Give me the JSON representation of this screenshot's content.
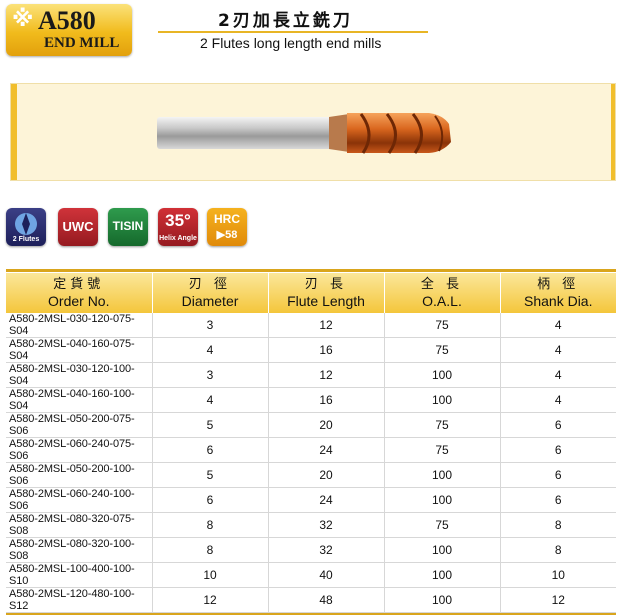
{
  "header": {
    "mark": "※",
    "model": "A580",
    "product_name": "END MILL",
    "title_zh": "2刃加長立銑刀",
    "title_en": "2 Flutes long length end mills"
  },
  "colors": {
    "accent_gold": "#f1be2c",
    "panel_bg": "#fdf4d8",
    "coating_orange": "#d9661e"
  },
  "features": [
    {
      "id": "flutes",
      "icon": "two-flute-icon",
      "label": "2 Flutes",
      "color": "#2a2d6e"
    },
    {
      "id": "material",
      "icon": "uwc-icon",
      "label": "UWC",
      "color": "#c0282f"
    },
    {
      "id": "coating",
      "icon": "tisin-icon",
      "label": "TISIN",
      "color": "#1f7f3a"
    },
    {
      "id": "helix",
      "icon": "helix-icon",
      "value": "35°",
      "label": "Helix Angle",
      "color": "#c0282f"
    },
    {
      "id": "hrc",
      "icon": "hrc-icon",
      "label": "HRC",
      "value": "▶58",
      "color": "#f0a81a"
    }
  ],
  "table": {
    "columns": [
      {
        "zh": "定貨號",
        "en": "Order No."
      },
      {
        "zh": "刃 徑",
        "en": "Diameter"
      },
      {
        "zh": "刃 長",
        "en": "Flute Length"
      },
      {
        "zh": "全 長",
        "en": "O.A.L."
      },
      {
        "zh": "柄 徑",
        "en": "Shank Dia."
      }
    ],
    "rows": [
      [
        "A580-2MSL-030-120-075-S04",
        "3",
        "12",
        "75",
        "4"
      ],
      [
        "A580-2MSL-040-160-075-S04",
        "4",
        "16",
        "75",
        "4"
      ],
      [
        "A580-2MSL-030-120-100-S04",
        "3",
        "12",
        "100",
        "4"
      ],
      [
        "A580-2MSL-040-160-100-S04",
        "4",
        "16",
        "100",
        "4"
      ],
      [
        "A580-2MSL-050-200-075-S06",
        "5",
        "20",
        "75",
        "6"
      ],
      [
        "A580-2MSL-060-240-075-S06",
        "6",
        "24",
        "75",
        "6"
      ],
      [
        "A580-2MSL-050-200-100-S06",
        "5",
        "20",
        "100",
        "6"
      ],
      [
        "A580-2MSL-060-240-100-S06",
        "6",
        "24",
        "100",
        "6"
      ],
      [
        "A580-2MSL-080-320-075-S08",
        "8",
        "32",
        "75",
        "8"
      ],
      [
        "A580-2MSL-080-320-100-S08",
        "8",
        "32",
        "100",
        "8"
      ],
      [
        "A580-2MSL-100-400-100-S10",
        "10",
        "40",
        "100",
        "10"
      ],
      [
        "A580-2MSL-120-480-100-S12",
        "12",
        "48",
        "100",
        "12"
      ]
    ]
  }
}
